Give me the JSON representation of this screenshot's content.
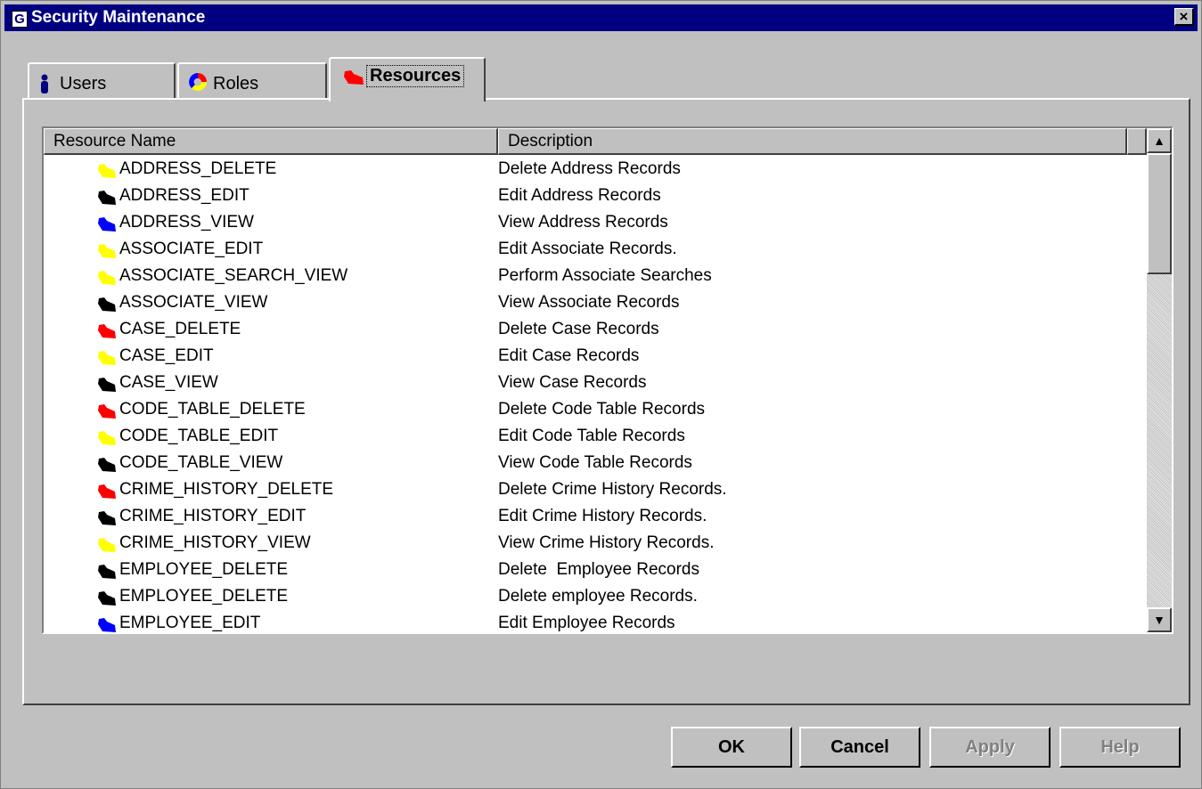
{
  "window": {
    "title": "Security Maintenance",
    "app_icon": "G",
    "close_label": "×"
  },
  "tabs": [
    {
      "label": "Users",
      "icon": "person-icon",
      "active": false
    },
    {
      "label": "Roles",
      "icon": "roles-ring-icon",
      "active": false
    },
    {
      "label": "Resources",
      "icon": "resource-icon",
      "active": true
    }
  ],
  "table": {
    "columns": [
      "Resource Name",
      "Description"
    ],
    "rows": [
      {
        "name": "ADDRESS_DELETE",
        "description": "Delete Address Records",
        "icon_color": "#ffff00"
      },
      {
        "name": "ADDRESS_EDIT",
        "description": "Edit Address Records",
        "icon_color": "#000000"
      },
      {
        "name": "ADDRESS_VIEW",
        "description": "View Address Records",
        "icon_color": "#0000ff"
      },
      {
        "name": "ASSOCIATE_EDIT",
        "description": "Edit Associate Records.",
        "icon_color": "#ffff00"
      },
      {
        "name": "ASSOCIATE_SEARCH_VIEW",
        "description": "Perform Associate Searches",
        "icon_color": "#ffff00"
      },
      {
        "name": "ASSOCIATE_VIEW",
        "description": "View Associate Records",
        "icon_color": "#000000"
      },
      {
        "name": "CASE_DELETE",
        "description": "Delete Case Records",
        "icon_color": "#ff0000"
      },
      {
        "name": "CASE_EDIT",
        "description": "Edit Case Records",
        "icon_color": "#ffff00"
      },
      {
        "name": "CASE_VIEW",
        "description": "View Case Records",
        "icon_color": "#000000"
      },
      {
        "name": "CODE_TABLE_DELETE",
        "description": "Delete Code Table Records",
        "icon_color": "#ff0000"
      },
      {
        "name": "CODE_TABLE_EDIT",
        "description": "Edit Code Table Records",
        "icon_color": "#ffff00"
      },
      {
        "name": "CODE_TABLE_VIEW",
        "description": "View Code Table Records",
        "icon_color": "#000000"
      },
      {
        "name": "CRIME_HISTORY_DELETE",
        "description": "Delete Crime History Records.",
        "icon_color": "#ff0000"
      },
      {
        "name": "CRIME_HISTORY_EDIT",
        "description": "Edit Crime History Records.",
        "icon_color": "#000000"
      },
      {
        "name": "CRIME_HISTORY_VIEW",
        "description": "View Crime History Records.",
        "icon_color": "#ffff00"
      },
      {
        "name": "EMPLOYEE_DELETE",
        "description": "Delete  Employee Records",
        "icon_color": "#000000"
      },
      {
        "name": "EMPLOYEE_DELETE",
        "description": "Delete employee Records.",
        "icon_color": "#000000"
      },
      {
        "name": "EMPLOYEE_EDIT",
        "description": "Edit Employee Records",
        "icon_color": "#0000ff"
      }
    ]
  },
  "scrollbar": {
    "up_glyph": "▲",
    "down_glyph": "▼"
  },
  "buttons": {
    "ok": "OK",
    "cancel": "Cancel",
    "apply": "Apply",
    "help": "Help"
  }
}
